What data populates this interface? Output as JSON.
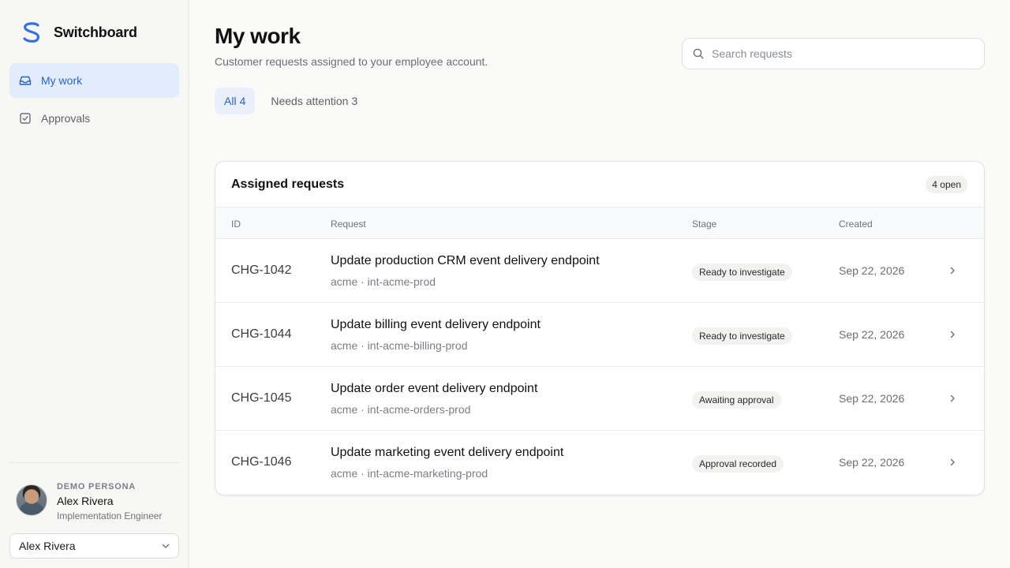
{
  "app": {
    "name": "Switchboard",
    "accent_color": "#2c5fc4",
    "logo_color": "#3b6fd8"
  },
  "sidebar": {
    "items": [
      {
        "label": "My work",
        "icon": "inbox-icon",
        "active": true
      },
      {
        "label": "Approvals",
        "icon": "checkbox-icon",
        "active": false
      }
    ],
    "persona": {
      "kicker": "DEMO PERSONA",
      "name": "Alex Rivera",
      "role": "Implementation Engineer"
    },
    "persona_select": {
      "value": "Alex Rivera"
    }
  },
  "header": {
    "title": "My work",
    "subtitle": "Customer requests assigned to your employee account."
  },
  "search": {
    "placeholder": "Search requests"
  },
  "tabs": [
    {
      "label": "All",
      "count": "4",
      "active": true
    },
    {
      "label": "Needs attention",
      "count": "3",
      "active": false
    }
  ],
  "table": {
    "title": "Assigned requests",
    "badge": "4 open",
    "columns": [
      "ID",
      "Request",
      "Stage",
      "Created"
    ],
    "rows": [
      {
        "id": "CHG-1042",
        "title": "Update production CRM event delivery endpoint",
        "subtitle": "acme · int-acme-prod",
        "stage": "Ready to investigate",
        "created": "Sep 22, 2026"
      },
      {
        "id": "CHG-1044",
        "title": "Update billing event delivery endpoint",
        "subtitle": "acme · int-acme-billing-prod",
        "stage": "Ready to investigate",
        "created": "Sep 22, 2026"
      },
      {
        "id": "CHG-1045",
        "title": "Update order event delivery endpoint",
        "subtitle": "acme · int-acme-orders-prod",
        "stage": "Awaiting approval",
        "created": "Sep 22, 2026"
      },
      {
        "id": "CHG-1046",
        "title": "Update marketing event delivery endpoint",
        "subtitle": "acme · int-acme-marketing-prod",
        "stage": "Approval recorded",
        "created": "Sep 22, 2026"
      }
    ]
  }
}
